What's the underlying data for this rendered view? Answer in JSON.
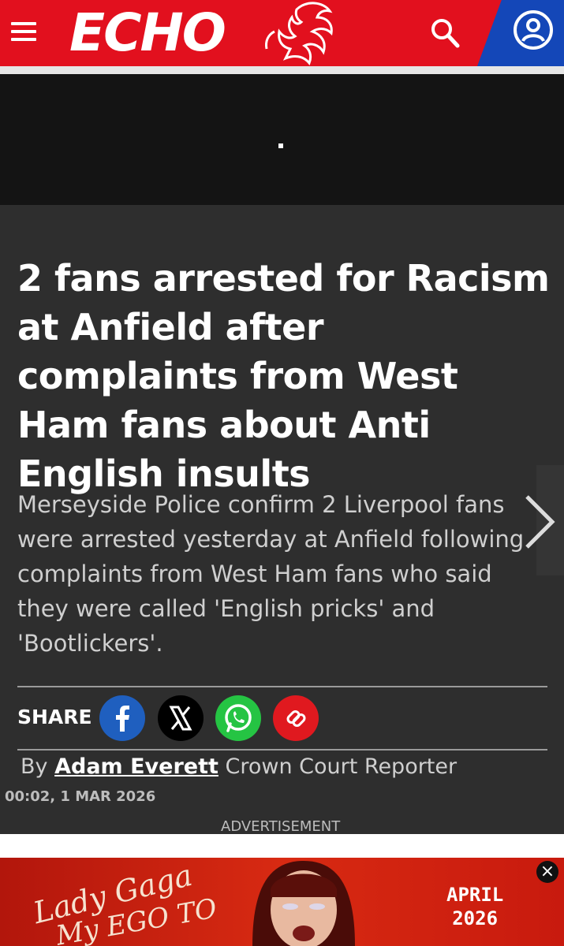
{
  "header": {
    "logo": "ECHO",
    "menu_icon": "hamburger-menu-icon",
    "search_icon": "search-icon",
    "account_icon": "user-account-icon",
    "colors": {
      "brand_red": "#e2101e",
      "account_blue": "#1447b8"
    }
  },
  "article": {
    "headline": "2 fans arrested for Racism at Anfield after complaints from West Ham fans about Anti English insults",
    "standfirst": "Merseyside Police confirm 2 Liverpool fans were arrested yesterday at Anfield following complaints from West Ham fans who said they were called 'English pricks' and 'Bootlickers'.",
    "share_label": "SHARE",
    "share_buttons": [
      {
        "icon": "facebook-icon",
        "color": "#1f5fbf"
      },
      {
        "icon": "x-icon",
        "color": "#000000"
      },
      {
        "icon": "whatsapp-icon",
        "color": "#25c443"
      },
      {
        "icon": "link-icon",
        "color": "#e0191f"
      }
    ],
    "byline_prefix": "By",
    "author": "Adam Everett",
    "author_role": "Crown Court Reporter",
    "date": "00:02, 1 MAR 2026"
  },
  "advertisement": {
    "label": "ADVERTISEMENT",
    "script_line1": "Lady Gaga",
    "script_line2": "My EGO TO",
    "date_line1": "APRIL",
    "date_line2": "2026",
    "close_symbol": "×"
  }
}
